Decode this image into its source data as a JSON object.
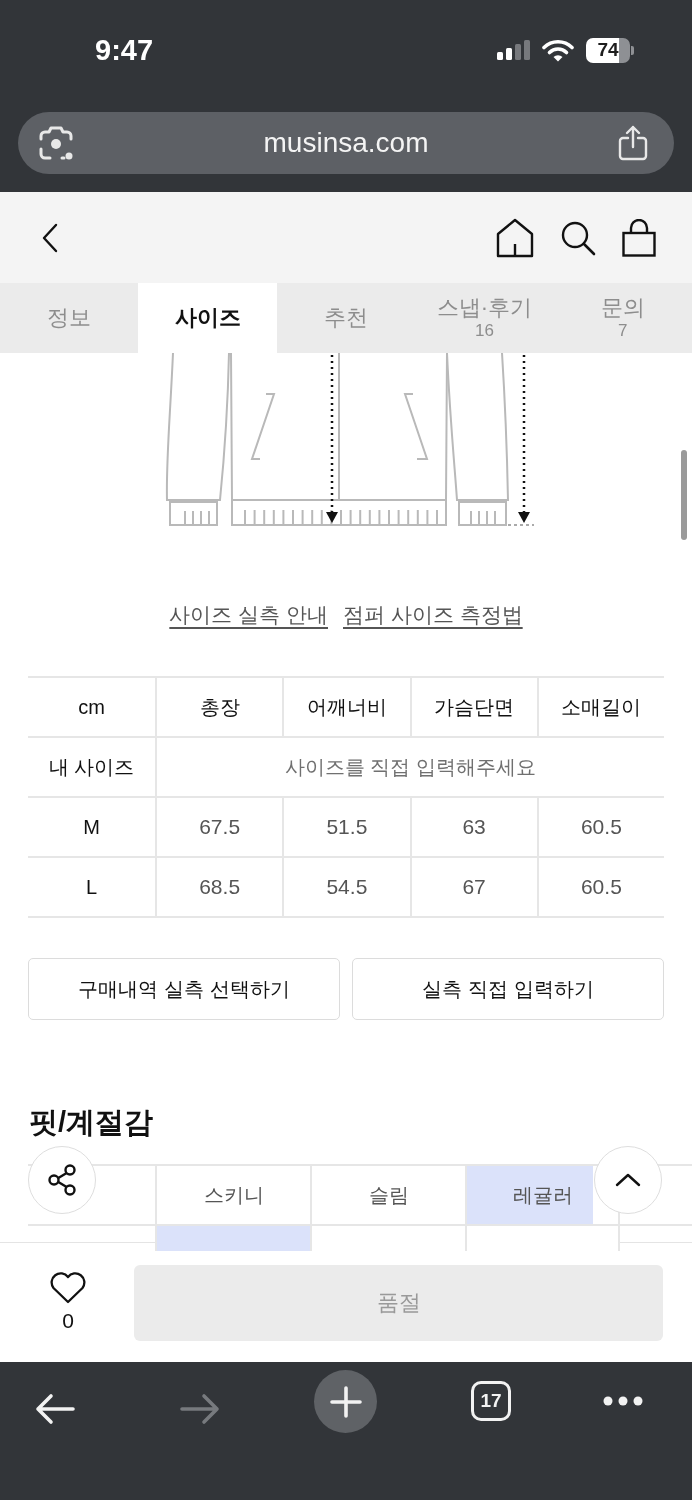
{
  "status_bar": {
    "time": "9:47",
    "battery": "74"
  },
  "browser": {
    "url": "musinsa.com"
  },
  "tabs": [
    {
      "label": "정보",
      "selected": false
    },
    {
      "label": "사이즈",
      "selected": true
    },
    {
      "label": "추천",
      "selected": false
    },
    {
      "label": "스냅·후기",
      "count": "16",
      "selected": false
    },
    {
      "label": "문의",
      "count": "7",
      "selected": false
    }
  ],
  "size_guide_links": [
    "사이즈 실측 안내",
    "점퍼 사이즈 측정법"
  ],
  "size_table": {
    "columns": [
      "cm",
      "총장",
      "어깨너비",
      "가슴단면",
      "소매길이"
    ],
    "my_size": {
      "label": "내 사이즈",
      "placeholder": "사이즈를 직접 입력해주세요"
    },
    "rows": [
      {
        "size": "M",
        "values": [
          "67.5",
          "51.5",
          "63",
          "60.5"
        ]
      },
      {
        "size": "L",
        "values": [
          "68.5",
          "54.5",
          "67",
          "60.5"
        ]
      }
    ]
  },
  "size_buttons": [
    "구매내역 실측 선택하기",
    "실측 직접 입력하기"
  ],
  "fit_section": {
    "title": "핏/계절감",
    "rows": [
      {
        "options": [
          {
            "label": "스키니",
            "selected": false
          },
          {
            "label": "슬림",
            "selected": false
          },
          {
            "label": "레귤러",
            "selected": true
          }
        ]
      },
      {
        "options": [
          {
            "selected": true
          },
          {
            "selected": false
          },
          {
            "selected": false
          }
        ]
      }
    ]
  },
  "bottom_bar": {
    "likes": "0",
    "buy_button": {
      "label": "품절",
      "disabled": true
    }
  },
  "browser_toolbar": {
    "forward_disabled": true,
    "tab_count": "17"
  }
}
